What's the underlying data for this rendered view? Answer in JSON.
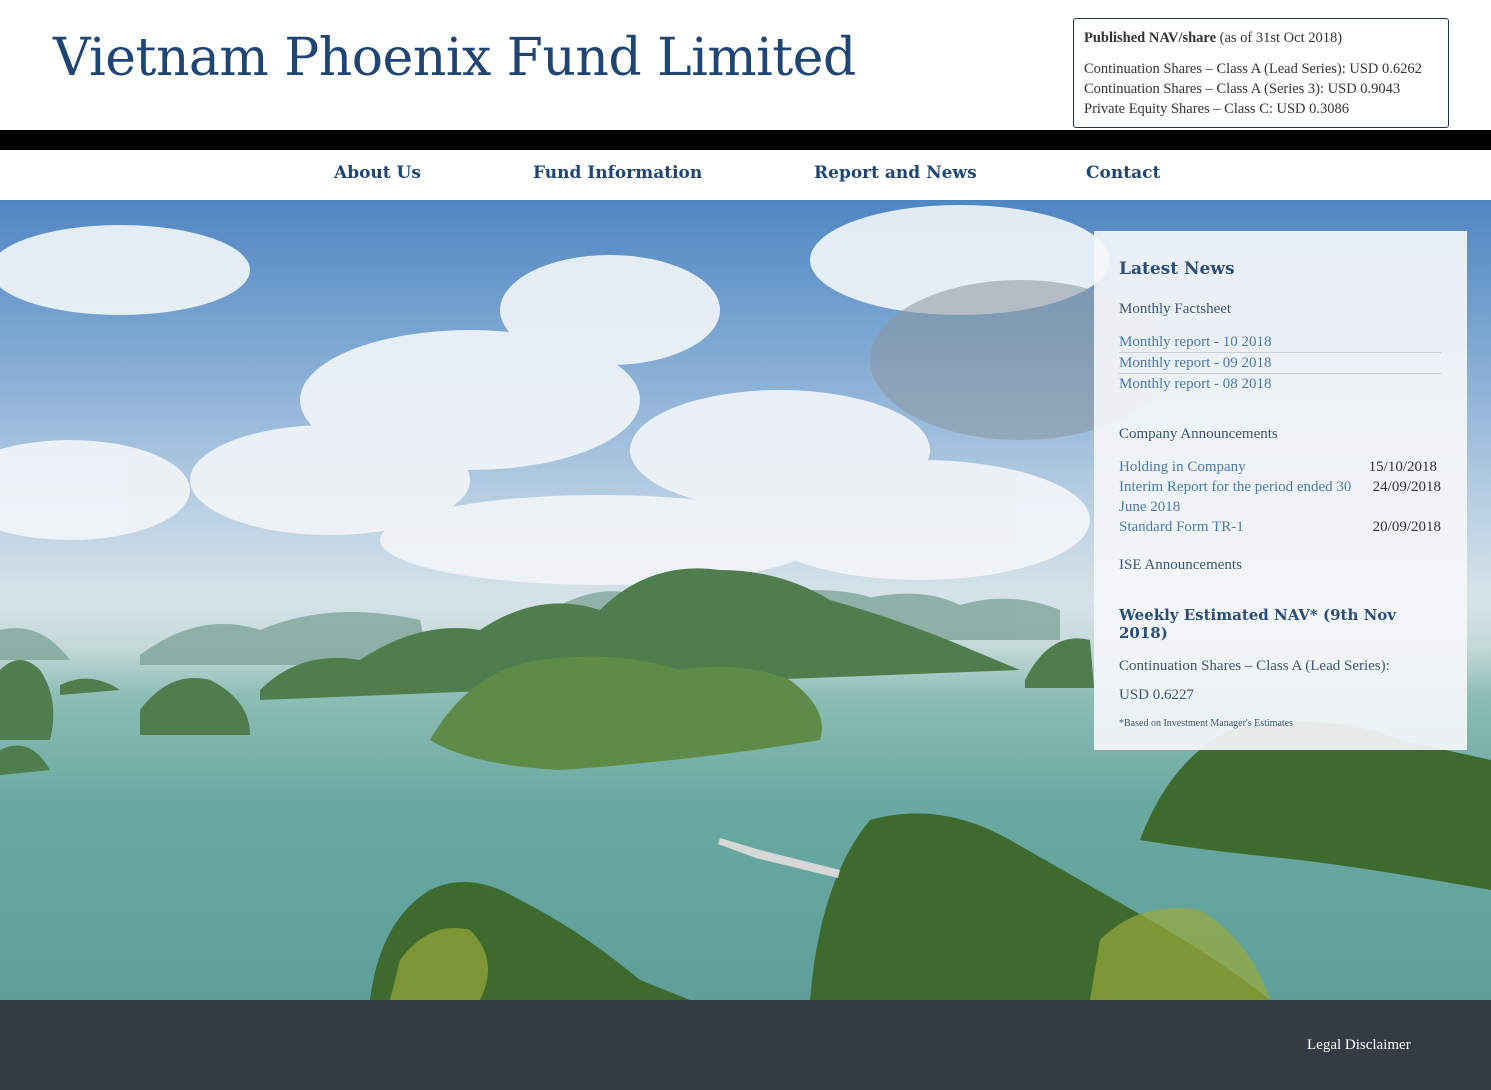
{
  "header": {
    "site_title": "Vietnam Phoenix Fund Limited"
  },
  "nav_box": {
    "heading_bold": "Published NAV/share",
    "heading_date": " (as of 31st Oct 2018)",
    "rows": [
      "Continuation Shares – Class A (Lead Series): USD 0.6262",
      "Continuation Shares – Class A (Series 3): USD 0.9043",
      "Private Equity Shares – Class C: USD 0.3086"
    ]
  },
  "menu": {
    "items": [
      {
        "label": "About Us"
      },
      {
        "label": "Fund Information"
      },
      {
        "label": "Report and News"
      },
      {
        "label": "Contact"
      }
    ]
  },
  "news": {
    "title": "Latest News",
    "factsheet_heading": "Monthly Factsheet",
    "reports": [
      {
        "label": "Monthly report - 10 2018"
      },
      {
        "label": "Monthly report - 09 2018"
      },
      {
        "label": "Monthly report - 08 2018"
      }
    ],
    "company_heading": "Company Announcements",
    "announcements": [
      {
        "title": "Holding in Company",
        "date": "15/10/2018"
      },
      {
        "title": "Interim Report for the period ended 30 June 2018",
        "date": "24/09/2018"
      },
      {
        "title": "Standard Form TR-1",
        "date": "20/09/2018"
      }
    ],
    "ise_heading": "ISE Announcements",
    "weekly_heading": "Weekly Estimated NAV* (9th Nov 2018)",
    "weekly_label": "Continuation Shares – Class A (Lead Series):",
    "weekly_value": "USD 0.6227",
    "footnote": "*Based on Investment Manager's Estimates"
  },
  "footer": {
    "legal_label": "Legal Disclaimer"
  },
  "colors": {
    "brand_blue": "#1f4574",
    "link_blue": "#4a7bb0",
    "footer_bg": "#343b44"
  }
}
